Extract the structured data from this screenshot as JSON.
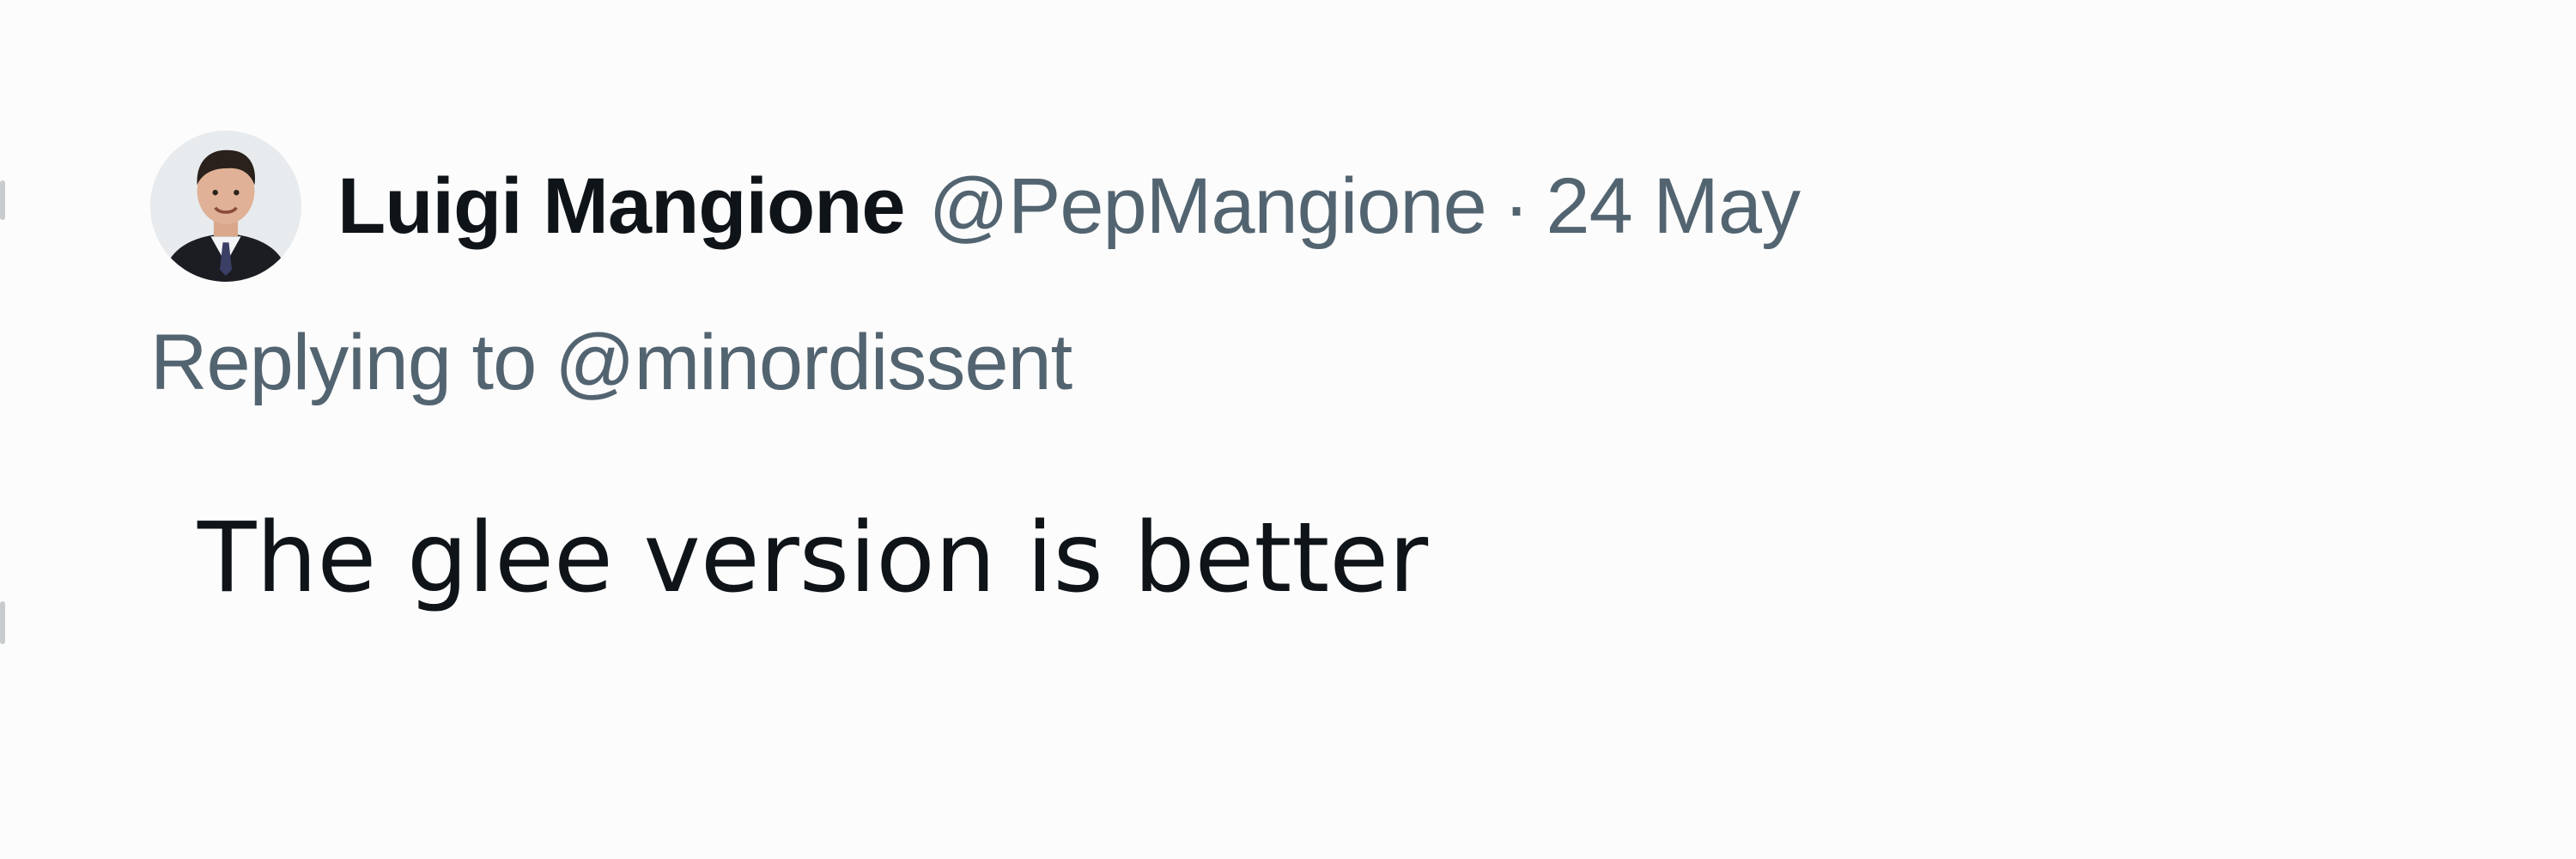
{
  "tweet": {
    "author": {
      "display_name": "Luigi Mangione",
      "handle": "@PepMangione",
      "avatar_icon": "user-avatar-icon"
    },
    "separator": "·",
    "date": "24 May",
    "reply": {
      "prefix": "Replying to",
      "mention": "@minordissent"
    },
    "text": "The glee version is better"
  },
  "colors": {
    "text_primary": "#0f1419",
    "text_secondary": "#536471",
    "background": "#fcfcfc"
  }
}
